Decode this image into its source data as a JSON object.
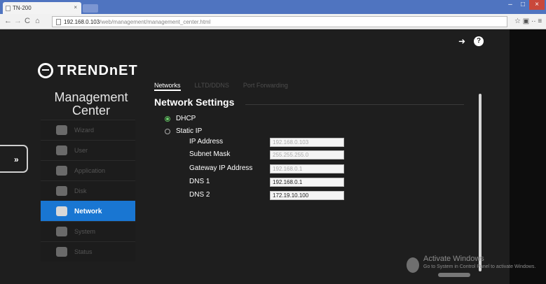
{
  "browser": {
    "tab_title": "TN-200",
    "tab_close": "×",
    "url_host": "192.168.0.103",
    "url_path": "/web/management/management_center.html",
    "window_controls": [
      "–",
      "□",
      "×"
    ]
  },
  "header": {
    "logo_text": "TRENDnET",
    "logout_icon": "logout-icon",
    "help_icon": "help-icon"
  },
  "sidebar": {
    "title_line1": "Management",
    "title_line2": "Center",
    "expand_label": "»",
    "items": [
      {
        "label": "Wizard",
        "icon": "wizard-icon"
      },
      {
        "label": "User",
        "icon": "user-icon"
      },
      {
        "label": "Application",
        "icon": "application-icon"
      },
      {
        "label": "Disk",
        "icon": "disk-icon"
      },
      {
        "label": "Network",
        "icon": "network-icon",
        "active": true
      },
      {
        "label": "System",
        "icon": "system-icon"
      },
      {
        "label": "Status",
        "icon": "status-icon"
      }
    ]
  },
  "main": {
    "tabs": [
      {
        "label": "Networks",
        "active": true
      },
      {
        "label": "LLTD/DDNS"
      },
      {
        "label": "Port Forwarding"
      }
    ],
    "section_title": "Network Settings",
    "radio_dhcp": "DHCP",
    "radio_static": "Static IP",
    "fields": [
      {
        "label": "IP Address",
        "value": "192.168.0.103"
      },
      {
        "label": "Subnet Mask",
        "value": "255.255.255.0"
      },
      {
        "label": "Gateway IP Address",
        "value": "192.168.0.1"
      },
      {
        "label": "DNS 1",
        "value": "192.168.0.1"
      },
      {
        "label": "DNS 2",
        "value": "172.19.10.100"
      }
    ]
  },
  "watermark": {
    "title": "Activate Windows",
    "subtitle": "Go to System in Control Panel to activate Windows."
  },
  "colors": {
    "accent": "#1976d2",
    "page_bg": "#1e1e1e",
    "dhcp_selected": "#6bd26b"
  }
}
